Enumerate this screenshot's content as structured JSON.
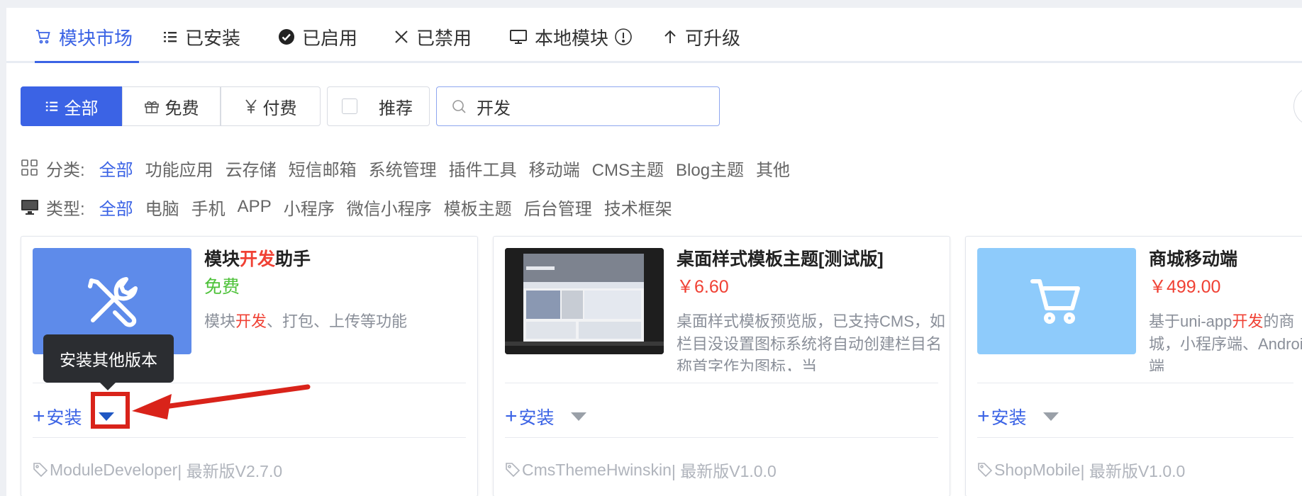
{
  "tabs": [
    {
      "label": "模块市场",
      "icon": "cart-icon",
      "active": true
    },
    {
      "label": "已安装",
      "icon": "list-icon"
    },
    {
      "label": "已启用",
      "icon": "check-circle-icon"
    },
    {
      "label": "已禁用",
      "icon": "close-icon"
    },
    {
      "label": "本地模块",
      "icon": "monitor-icon",
      "info_icon": "info-circle-icon"
    },
    {
      "label": "可升级",
      "icon": "arrow-up-icon"
    }
  ],
  "price_filter": {
    "all": "全部",
    "free": "免费",
    "paid": "付费",
    "recommend": "推荐",
    "selected": "全部"
  },
  "search": {
    "value": "开发",
    "icon": "search-icon"
  },
  "category": {
    "label": "分类:",
    "icon": "grid-icon",
    "options": [
      "全部",
      "功能应用",
      "云存储",
      "短信邮箱",
      "系统管理",
      "插件工具",
      "移动端",
      "CMS主题",
      "Blog主题",
      "其他"
    ],
    "selected": "全部"
  },
  "type": {
    "label": "类型:",
    "icon": "monitor-icon",
    "options": [
      "全部",
      "电脑",
      "手机",
      "APP",
      "小程序",
      "微信小程序",
      "模板主题",
      "后台管理",
      "技术框架"
    ],
    "selected": "全部"
  },
  "cards": [
    {
      "title_pre": "模块",
      "title_hl": "开发",
      "title_post": "助手",
      "price": "免费",
      "desc_pre": "模块",
      "desc_hl": "开发",
      "desc_post": "、打包、上传等功能",
      "install_label": "安装",
      "code": "ModuleDeveloper",
      "version": " | 最新版V2.7.0",
      "thumb_color": "#5e8bea",
      "thumb_icon": "tools-icon"
    },
    {
      "title": "桌面样式模板主题[测试版]",
      "price": "￥6.60",
      "desc": "桌面样式模板预览版，已支持CMS，如栏目没设置图标系统将自动创建栏目名称首字作为图标，当",
      "install_label": "安装",
      "code": "CmsThemeHwinskin",
      "version": " | 最新版V1.0.0",
      "thumb_icon": "desktop-screenshot"
    },
    {
      "title": "商城移动端",
      "price": "￥499.00",
      "desc_pre": "基于uni-app",
      "desc_hl": "开发",
      "desc_post": "的商城，小程序端、Android端",
      "install_label": "安装",
      "code": "ShopMobile",
      "version": " | 最新版V1.0.0",
      "thumb_color": "#8ecbfb",
      "thumb_icon": "cart-icon"
    }
  ],
  "tooltip": "安装其他版本",
  "colors": {
    "accent": "#3b63e5",
    "highlight": "#f04134",
    "free": "#4ec23a",
    "annotation": "#d9231a"
  }
}
